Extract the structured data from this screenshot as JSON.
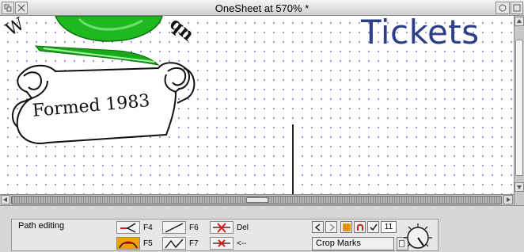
{
  "window": {
    "title": "OneSheet at 570% *"
  },
  "document": {
    "heading": "Tickets",
    "banner_text": "Formed 1983",
    "arc_letter_left": "W",
    "arc_letters_right": "qn"
  },
  "toolpane": {
    "mode_label": "Path editing",
    "tools": [
      {
        "icon": "line-join-icon",
        "key": "F4"
      },
      {
        "icon": "straight-line-icon",
        "key": "F6"
      },
      {
        "icon": "delete-node-icon",
        "key": "Del"
      },
      {
        "icon": "curve-icon",
        "key": "F5"
      },
      {
        "icon": "zigzag-icon",
        "key": "F7"
      },
      {
        "icon": "split-node-icon",
        "key": "<--"
      }
    ],
    "step_value": "11",
    "crop_field_value": "Crop Marks"
  },
  "colors": {
    "heading": "#2d3f88",
    "grid_dot": "#8a8fc0",
    "leaf_green": "#1fb81f",
    "tool_red": "#d81818",
    "highlight_orange": "#f0a000"
  }
}
